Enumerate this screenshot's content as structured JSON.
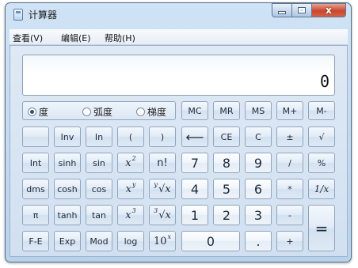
{
  "window": {
    "title": "计算器",
    "controls": {
      "close": "x"
    }
  },
  "menu": [
    "查看(V)",
    "编辑(E)",
    "帮助(H)"
  ],
  "display": {
    "value": "0"
  },
  "angle_modes": [
    {
      "label": "度",
      "selected": true
    },
    {
      "label": "弧度",
      "selected": false
    },
    {
      "label": "梯度",
      "selected": false
    }
  ],
  "memory_keys": [
    "MC",
    "MR",
    "MS",
    "M+",
    "M-"
  ],
  "keys": {
    "inv": "Inv",
    "ln": "In",
    "lparen": "(",
    "rparen": ")",
    "backspace": "⟵",
    "ce": "CE",
    "c": "C",
    "plusminus": "±",
    "sqrt": "√",
    "int": "Int",
    "sinh": "sinh",
    "sin": "sin",
    "x2_base": "x",
    "x2_exp": "2",
    "fact": "n!",
    "n7": "7",
    "n8": "8",
    "n9": "9",
    "div": "/",
    "pct": "%",
    "dms": "dms",
    "cosh": "cosh",
    "cos": "cos",
    "xy_base": "x",
    "xy_exp": "y",
    "yroot_pre": "y",
    "yroot_rest": "√x",
    "n4": "4",
    "n5": "5",
    "n6": "6",
    "mul": "*",
    "recip": "1/x",
    "pi": "π",
    "tanh": "tanh",
    "tan": "tan",
    "x3_base": "x",
    "x3_exp": "3",
    "root3_pre": "3",
    "root3_rest": "√x",
    "n1": "1",
    "n2": "2",
    "n3": "3",
    "sub": "-",
    "eq": "=",
    "fe": "F-E",
    "exp": "Exp",
    "mod": "Mod",
    "log": "log",
    "tenx_base": "10",
    "tenx_exp": "x",
    "n0": "0",
    "dot": ".",
    "add": "+"
  }
}
